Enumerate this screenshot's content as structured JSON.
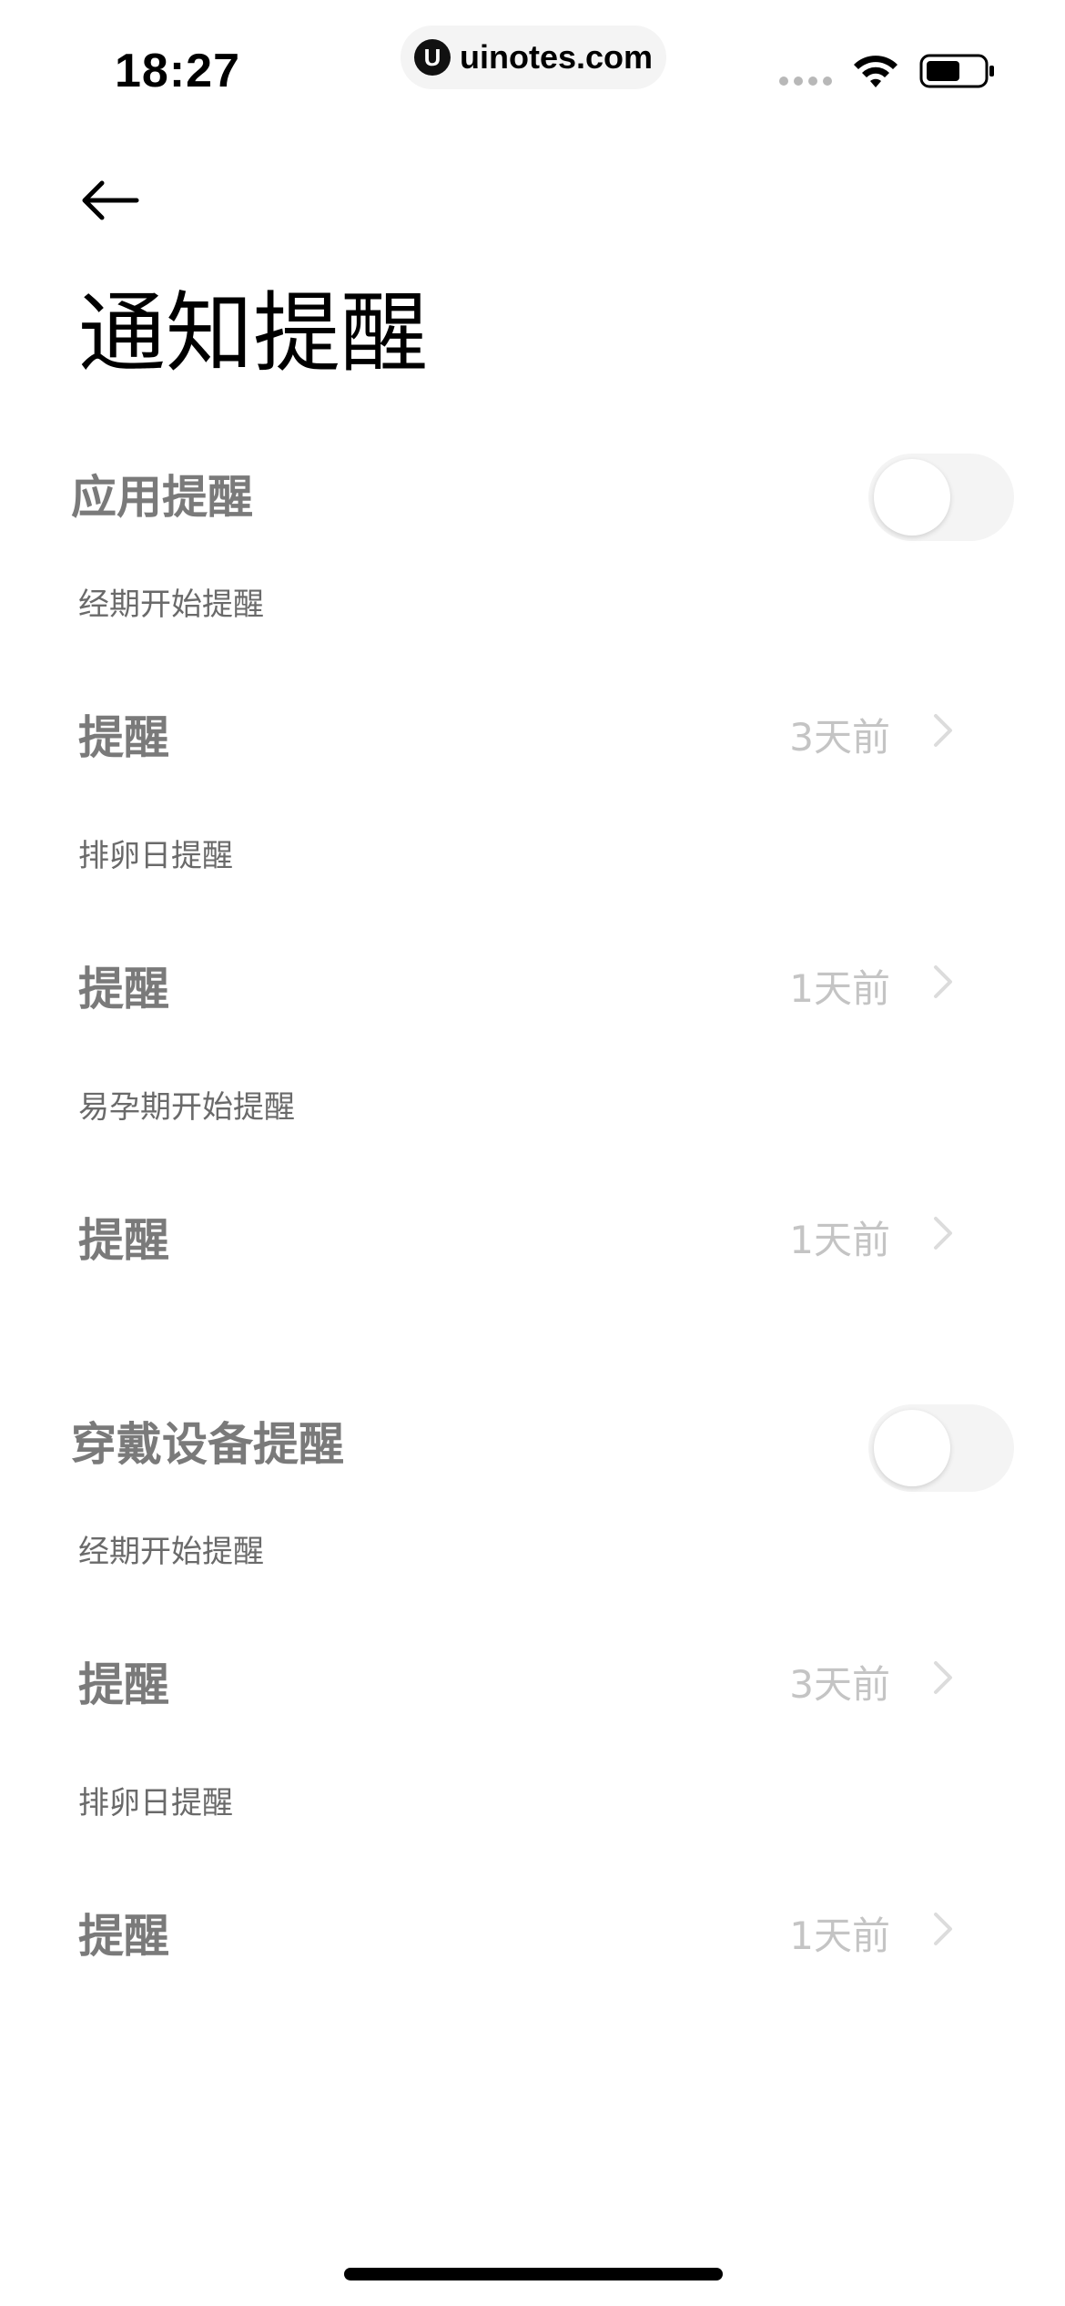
{
  "status_bar": {
    "time": "18:27",
    "url": "uinotes.com",
    "url_logo": "U"
  },
  "header": {
    "back_icon": "arrow-left-icon",
    "title": "通知提醒"
  },
  "sections": [
    {
      "title": "应用提醒",
      "toggle_on": false,
      "items": [
        {
          "label": "经期开始提醒",
          "row_label": "提醒",
          "value": "3天前"
        },
        {
          "label": "排卵日提醒",
          "row_label": "提醒",
          "value": "1天前"
        },
        {
          "label": "易孕期开始提醒",
          "row_label": "提醒",
          "value": "1天前"
        }
      ]
    },
    {
      "title": "穿戴设备提醒",
      "toggle_on": false,
      "items": [
        {
          "label": "经期开始提醒",
          "row_label": "提醒",
          "value": "3天前"
        },
        {
          "label": "排卵日提醒",
          "row_label": "提醒",
          "value": "1天前"
        }
      ]
    }
  ],
  "colors": {
    "section_text": "#7a7a7a",
    "value_text": "#c4c4c4",
    "toggle_track": "#f4f4f4"
  }
}
